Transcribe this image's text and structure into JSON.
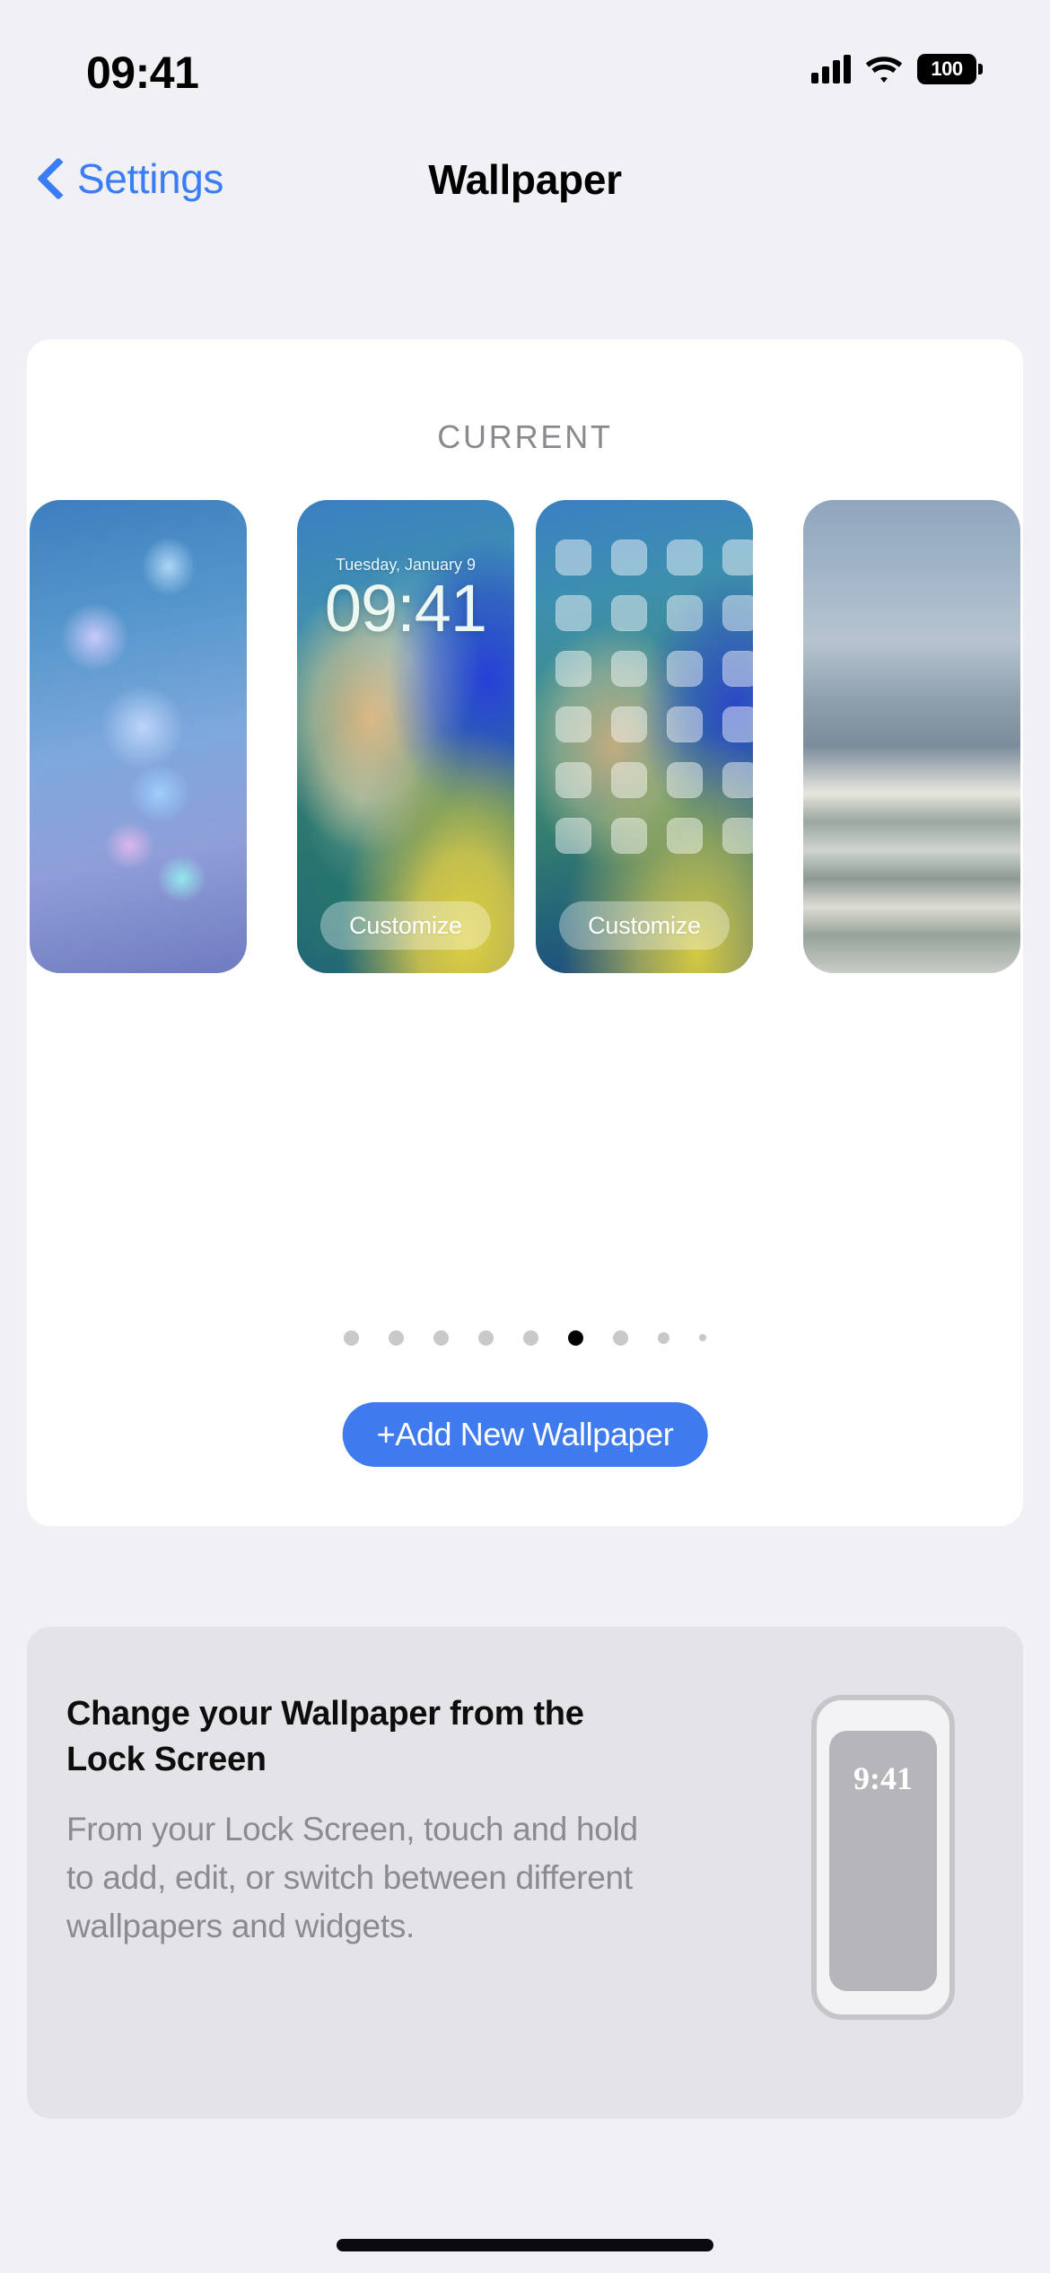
{
  "status_bar": {
    "time": "09:41",
    "battery_level": "100",
    "signal_icon": "cellular-signal-icon",
    "wifi_icon": "wifi-icon",
    "battery_icon": "battery-icon"
  },
  "nav": {
    "back_label": "Settings",
    "back_icon": "chevron-left-icon",
    "title": "Wallpaper"
  },
  "current_section": {
    "label": "CURRENT",
    "lock_preview": {
      "date": "Tuesday, January 9",
      "time": "09:41",
      "customize_label": "Customize"
    },
    "home_preview": {
      "customize_label": "Customize",
      "icon_rows": 6,
      "icon_cols": 4
    },
    "page_dots": {
      "total": 9,
      "active_index": 5
    },
    "add_button": {
      "label": "+Add New Wallpaper",
      "color": "#3f7bef"
    }
  },
  "info_card": {
    "title": "Change your Wallpaper from the Lock Screen",
    "body": "From your Lock Screen, touch and hold to add, edit, or switch between different wallpapers and widgets.",
    "illustration": {
      "icon": "iphone-illustration-icon",
      "screen_time": "9:41"
    }
  },
  "home_indicator": "home-indicator"
}
